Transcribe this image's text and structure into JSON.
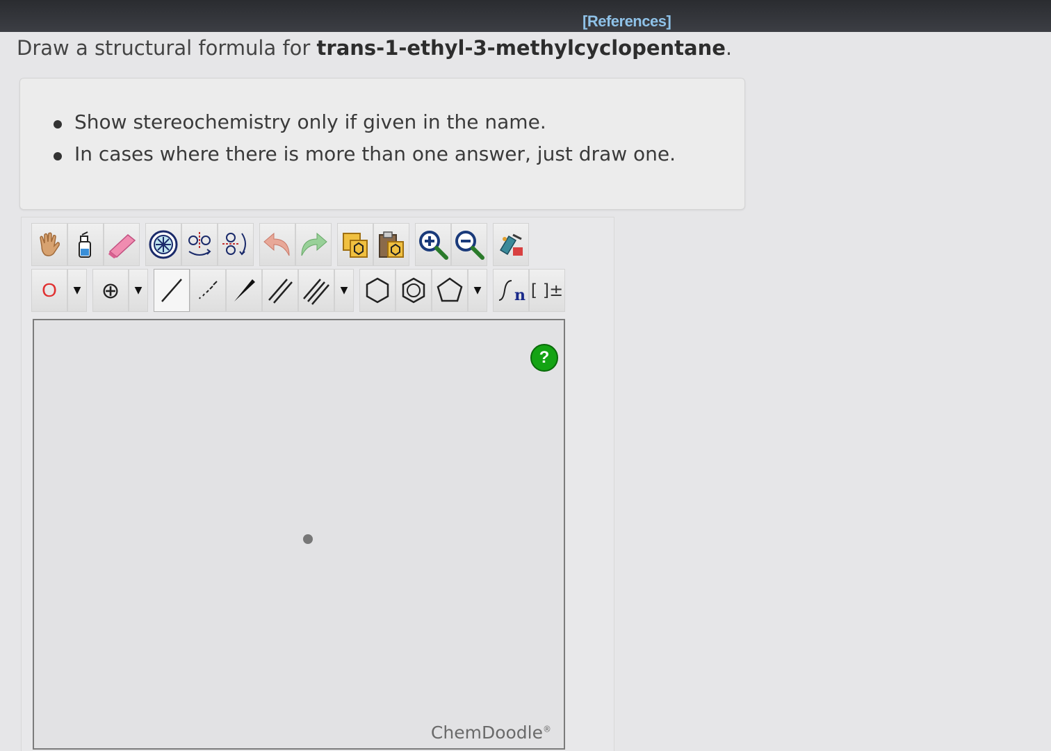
{
  "header": {
    "references_label": "[References]"
  },
  "question": {
    "prefix": "Draw a structural formula for ",
    "compound": "trans-1-ethyl-3-methylcyclopentane",
    "suffix": "."
  },
  "instructions": [
    "Show stereochemistry only if given in the name.",
    "In cases where there is more than one answer, just draw one."
  ],
  "toolbar_row1": [
    {
      "name": "hand-icon"
    },
    {
      "name": "clear-bottle-icon"
    },
    {
      "name": "eraser-icon"
    },
    {
      "name": "center-molecule-icon"
    },
    {
      "name": "flip-horizontal-icon"
    },
    {
      "name": "flip-vertical-icon"
    },
    {
      "name": "undo-icon"
    },
    {
      "name": "redo-icon"
    },
    {
      "name": "copy-icon"
    },
    {
      "name": "paste-icon"
    },
    {
      "name": "zoom-in-icon"
    },
    {
      "name": "zoom-out-icon"
    },
    {
      "name": "clean-icon"
    }
  ],
  "toolbar_row2": {
    "atom_label": "O",
    "charge_symbol": "⊕",
    "bond_tools": [
      "single-bond",
      "hashed-wedge-bond",
      "wedge-bond",
      "double-bond",
      "triple-bond"
    ],
    "ring_tools": [
      "cyclohexane",
      "benzene",
      "cyclopentane"
    ],
    "repeat_label": "n",
    "bracket_label": "[ ]±"
  },
  "canvas": {
    "help_label": "?",
    "brand": "ChemDoodle",
    "brand_mark": "®"
  },
  "colors": {
    "accent": "#8fc2e8",
    "help_green": "#14a314",
    "atom_red": "#e03030"
  }
}
